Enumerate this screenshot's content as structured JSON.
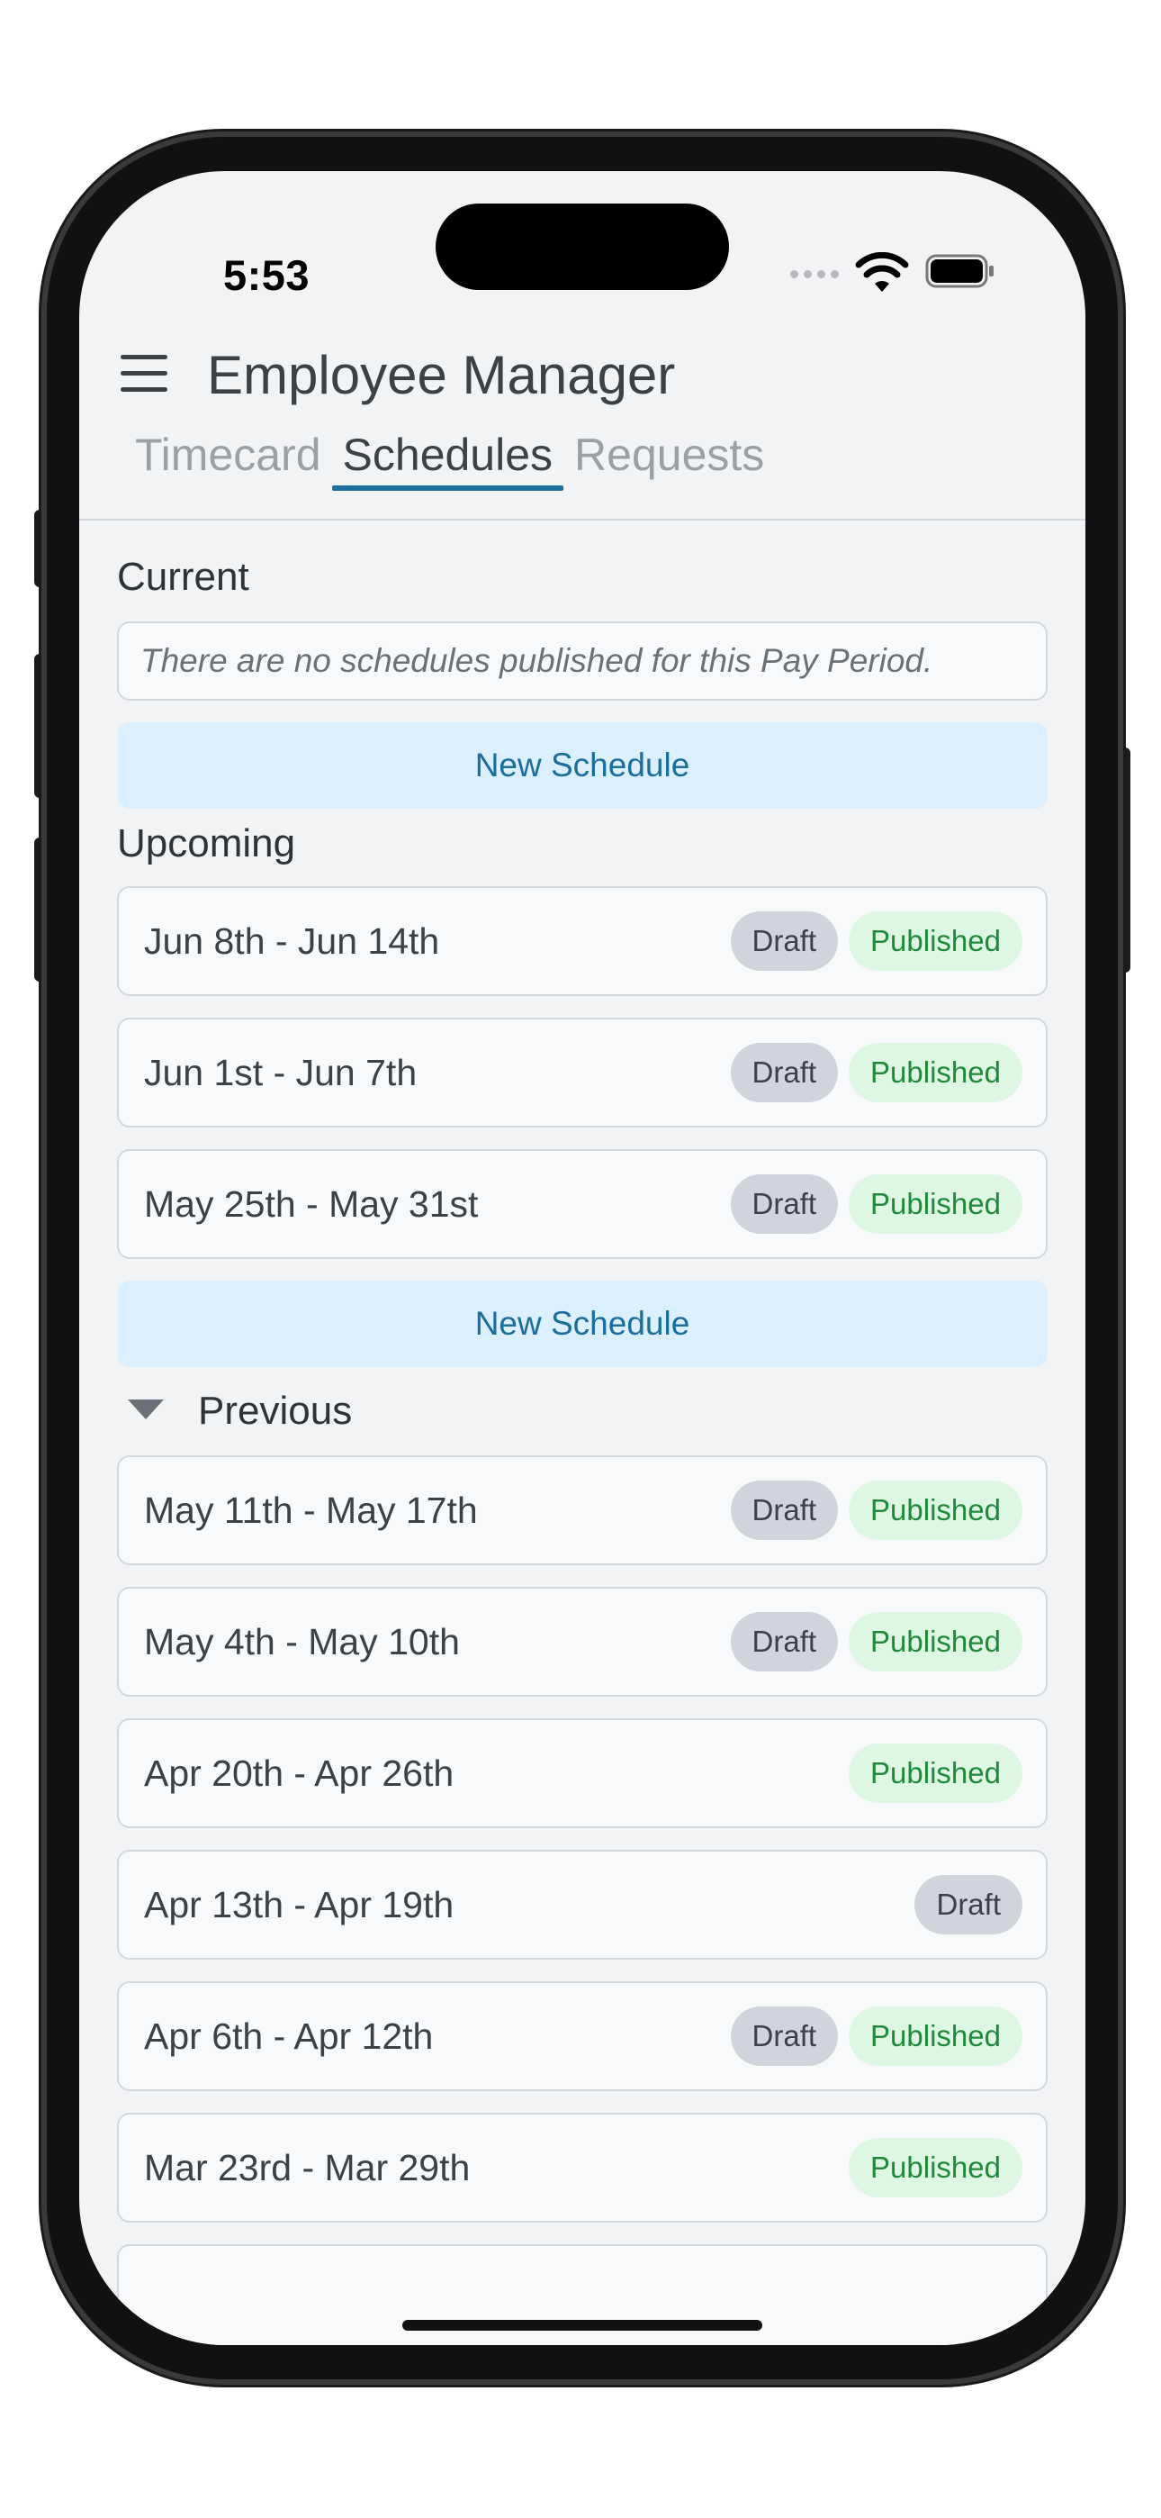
{
  "status_bar": {
    "time": "5:53"
  },
  "header": {
    "title": "Employee Manager"
  },
  "tabs": [
    {
      "label": "Timecard",
      "active": false
    },
    {
      "label": "Schedules",
      "active": true
    },
    {
      "label": "Requests",
      "active": false
    }
  ],
  "current": {
    "title": "Current",
    "empty_message": "There are no schedules published for this Pay Period.",
    "new_button": "New Schedule"
  },
  "upcoming": {
    "title": "Upcoming",
    "rows": [
      {
        "label": "Jun 8th - Jun 14th",
        "draft": "Draft",
        "published": "Published"
      },
      {
        "label": "Jun 1st - Jun 7th",
        "draft": "Draft",
        "published": "Published"
      },
      {
        "label": "May 25th - May 31st",
        "draft": "Draft",
        "published": "Published"
      }
    ],
    "new_button": "New Schedule"
  },
  "previous": {
    "title": "Previous",
    "rows": [
      {
        "label": "May 11th - May 17th",
        "draft": "Draft",
        "published": "Published"
      },
      {
        "label": "May 4th - May 10th",
        "draft": "Draft",
        "published": "Published"
      },
      {
        "label": "Apr 20th - Apr 26th",
        "published": "Published"
      },
      {
        "label": "Apr 13th - Apr 19th",
        "draft": "Draft"
      },
      {
        "label": "Apr 6th - Apr 12th",
        "draft": "Draft",
        "published": "Published"
      },
      {
        "label": "Mar 23rd - Mar 29th",
        "published": "Published"
      },
      {
        "label": ""
      }
    ]
  },
  "colors": {
    "accent": "#1a6f9c",
    "new_button_bg": "#dcefff",
    "draft_badge_bg": "#d1d5db",
    "published_badge_bg": "#ddf7e3",
    "published_text": "#1f8a3a"
  },
  "icons": {
    "menu": "hamburger-menu-icon",
    "collapse": "triangle-down-icon",
    "wifi": "wifi-icon",
    "battery": "battery-icon",
    "signal": "cellular-signal-icon"
  }
}
